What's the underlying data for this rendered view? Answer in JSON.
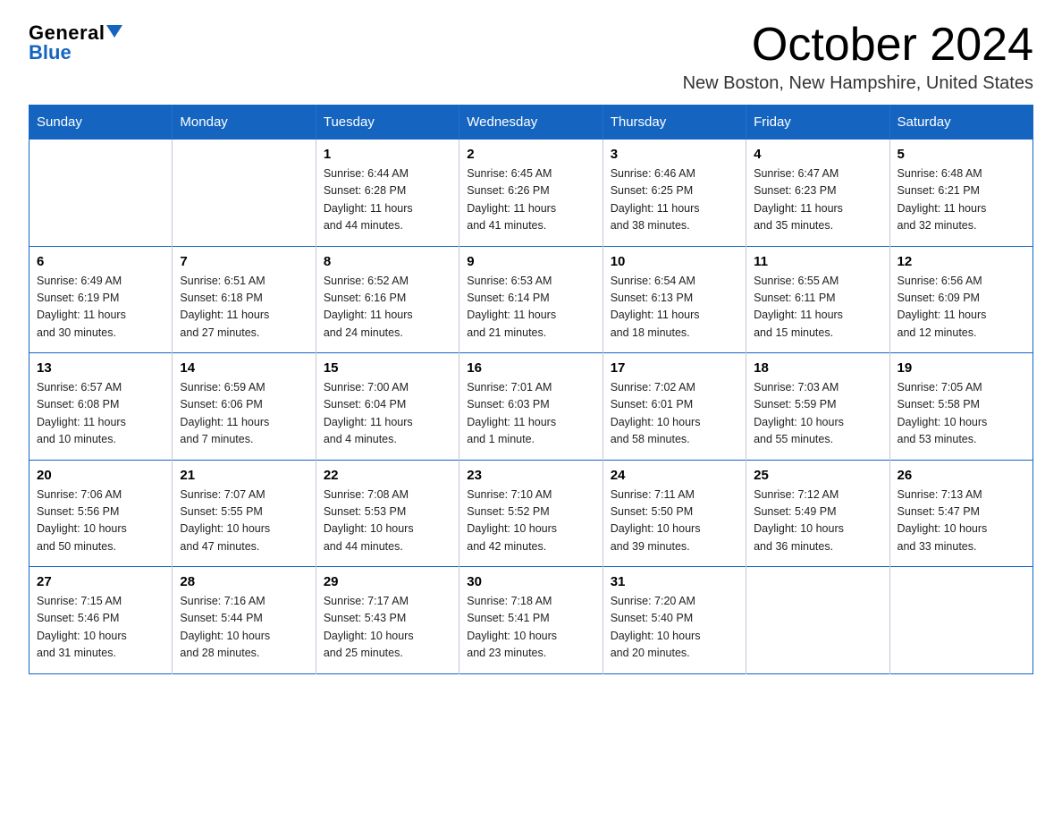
{
  "header": {
    "logo_general": "General",
    "logo_blue": "Blue",
    "title": "October 2024",
    "subtitle": "New Boston, New Hampshire, United States"
  },
  "days_of_week": [
    "Sunday",
    "Monday",
    "Tuesday",
    "Wednesday",
    "Thursday",
    "Friday",
    "Saturday"
  ],
  "weeks": [
    [
      {
        "day": "",
        "info": ""
      },
      {
        "day": "",
        "info": ""
      },
      {
        "day": "1",
        "info": "Sunrise: 6:44 AM\nSunset: 6:28 PM\nDaylight: 11 hours\nand 44 minutes."
      },
      {
        "day": "2",
        "info": "Sunrise: 6:45 AM\nSunset: 6:26 PM\nDaylight: 11 hours\nand 41 minutes."
      },
      {
        "day": "3",
        "info": "Sunrise: 6:46 AM\nSunset: 6:25 PM\nDaylight: 11 hours\nand 38 minutes."
      },
      {
        "day": "4",
        "info": "Sunrise: 6:47 AM\nSunset: 6:23 PM\nDaylight: 11 hours\nand 35 minutes."
      },
      {
        "day": "5",
        "info": "Sunrise: 6:48 AM\nSunset: 6:21 PM\nDaylight: 11 hours\nand 32 minutes."
      }
    ],
    [
      {
        "day": "6",
        "info": "Sunrise: 6:49 AM\nSunset: 6:19 PM\nDaylight: 11 hours\nand 30 minutes."
      },
      {
        "day": "7",
        "info": "Sunrise: 6:51 AM\nSunset: 6:18 PM\nDaylight: 11 hours\nand 27 minutes."
      },
      {
        "day": "8",
        "info": "Sunrise: 6:52 AM\nSunset: 6:16 PM\nDaylight: 11 hours\nand 24 minutes."
      },
      {
        "day": "9",
        "info": "Sunrise: 6:53 AM\nSunset: 6:14 PM\nDaylight: 11 hours\nand 21 minutes."
      },
      {
        "day": "10",
        "info": "Sunrise: 6:54 AM\nSunset: 6:13 PM\nDaylight: 11 hours\nand 18 minutes."
      },
      {
        "day": "11",
        "info": "Sunrise: 6:55 AM\nSunset: 6:11 PM\nDaylight: 11 hours\nand 15 minutes."
      },
      {
        "day": "12",
        "info": "Sunrise: 6:56 AM\nSunset: 6:09 PM\nDaylight: 11 hours\nand 12 minutes."
      }
    ],
    [
      {
        "day": "13",
        "info": "Sunrise: 6:57 AM\nSunset: 6:08 PM\nDaylight: 11 hours\nand 10 minutes."
      },
      {
        "day": "14",
        "info": "Sunrise: 6:59 AM\nSunset: 6:06 PM\nDaylight: 11 hours\nand 7 minutes."
      },
      {
        "day": "15",
        "info": "Sunrise: 7:00 AM\nSunset: 6:04 PM\nDaylight: 11 hours\nand 4 minutes."
      },
      {
        "day": "16",
        "info": "Sunrise: 7:01 AM\nSunset: 6:03 PM\nDaylight: 11 hours\nand 1 minute."
      },
      {
        "day": "17",
        "info": "Sunrise: 7:02 AM\nSunset: 6:01 PM\nDaylight: 10 hours\nand 58 minutes."
      },
      {
        "day": "18",
        "info": "Sunrise: 7:03 AM\nSunset: 5:59 PM\nDaylight: 10 hours\nand 55 minutes."
      },
      {
        "day": "19",
        "info": "Sunrise: 7:05 AM\nSunset: 5:58 PM\nDaylight: 10 hours\nand 53 minutes."
      }
    ],
    [
      {
        "day": "20",
        "info": "Sunrise: 7:06 AM\nSunset: 5:56 PM\nDaylight: 10 hours\nand 50 minutes."
      },
      {
        "day": "21",
        "info": "Sunrise: 7:07 AM\nSunset: 5:55 PM\nDaylight: 10 hours\nand 47 minutes."
      },
      {
        "day": "22",
        "info": "Sunrise: 7:08 AM\nSunset: 5:53 PM\nDaylight: 10 hours\nand 44 minutes."
      },
      {
        "day": "23",
        "info": "Sunrise: 7:10 AM\nSunset: 5:52 PM\nDaylight: 10 hours\nand 42 minutes."
      },
      {
        "day": "24",
        "info": "Sunrise: 7:11 AM\nSunset: 5:50 PM\nDaylight: 10 hours\nand 39 minutes."
      },
      {
        "day": "25",
        "info": "Sunrise: 7:12 AM\nSunset: 5:49 PM\nDaylight: 10 hours\nand 36 minutes."
      },
      {
        "day": "26",
        "info": "Sunrise: 7:13 AM\nSunset: 5:47 PM\nDaylight: 10 hours\nand 33 minutes."
      }
    ],
    [
      {
        "day": "27",
        "info": "Sunrise: 7:15 AM\nSunset: 5:46 PM\nDaylight: 10 hours\nand 31 minutes."
      },
      {
        "day": "28",
        "info": "Sunrise: 7:16 AM\nSunset: 5:44 PM\nDaylight: 10 hours\nand 28 minutes."
      },
      {
        "day": "29",
        "info": "Sunrise: 7:17 AM\nSunset: 5:43 PM\nDaylight: 10 hours\nand 25 minutes."
      },
      {
        "day": "30",
        "info": "Sunrise: 7:18 AM\nSunset: 5:41 PM\nDaylight: 10 hours\nand 23 minutes."
      },
      {
        "day": "31",
        "info": "Sunrise: 7:20 AM\nSunset: 5:40 PM\nDaylight: 10 hours\nand 20 minutes."
      },
      {
        "day": "",
        "info": ""
      },
      {
        "day": "",
        "info": ""
      }
    ]
  ]
}
